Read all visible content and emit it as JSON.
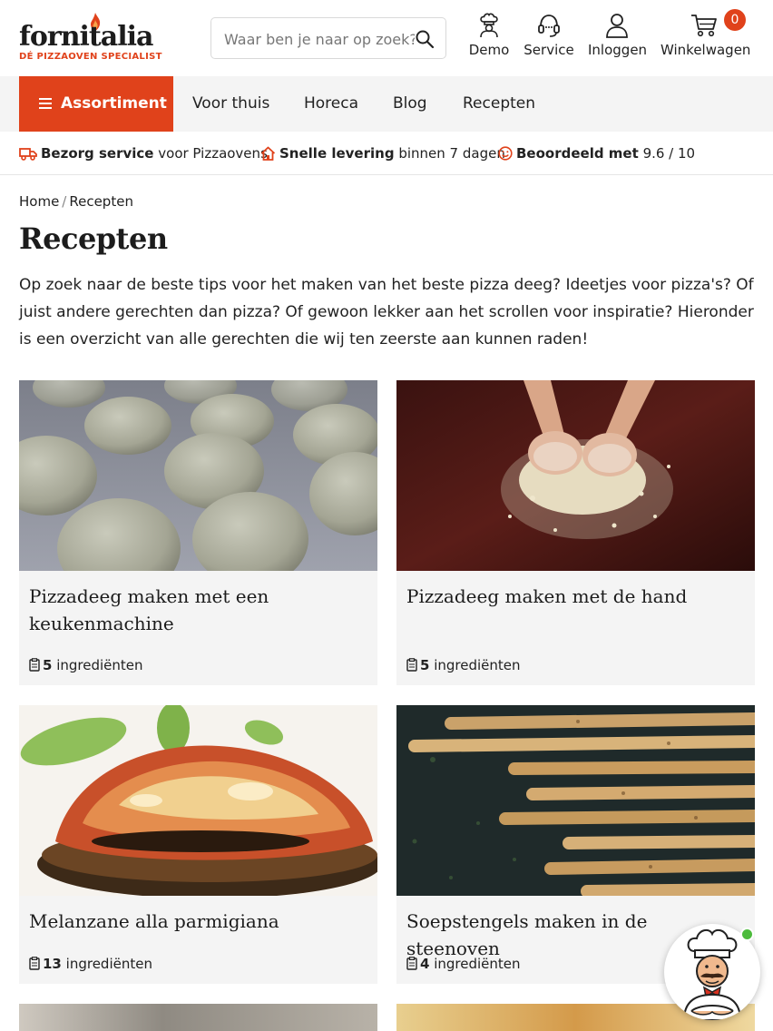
{
  "brand": {
    "name": "fornitalia",
    "tagline": "DÉ PIZZAOVEN SPECIALIST",
    "accent": "#e0421b"
  },
  "search": {
    "placeholder": "Waar ben je naar op zoek?",
    "icon": "search-icon"
  },
  "header_actions": {
    "demo": {
      "label": "Demo",
      "icon": "chef-icon"
    },
    "service": {
      "label": "Service",
      "icon": "headset-icon"
    },
    "login": {
      "label": "Inloggen",
      "icon": "user-icon"
    },
    "cart": {
      "label": "Winkelwagen",
      "icon": "cart-icon",
      "count": "0"
    }
  },
  "nav": {
    "assortment": "Assortiment",
    "items": [
      "Voor thuis",
      "Horeca",
      "Blog",
      "Recepten"
    ]
  },
  "usps": [
    {
      "icon": "truck-icon",
      "bold": "Bezorg service",
      "text": "voor Pizzaovens"
    },
    {
      "icon": "home-icon",
      "bold": "Snelle levering",
      "text": "binnen 7 dagen"
    },
    {
      "icon": "smiley-icon",
      "bold": "Beoordeeld met",
      "text": "9.6 / 10"
    }
  ],
  "breadcrumb": {
    "home": "Home",
    "separator": "/",
    "current": "Recepten"
  },
  "page": {
    "title": "Recepten",
    "intro": "Op zoek naar de beste tips voor het maken van het beste pizza deeg? Ideetjes voor pizza's? Of juist andere gerechten dan pizza? Of gewoon lekker aan het scrollen voor inspiratie? Hieronder is een overzicht van alle gerechten die wij ten zeerste aan kunnen raden!"
  },
  "recipes": [
    {
      "title": "Pizzadeeg maken met een keukenmachine",
      "count": "5",
      "unit": "ingrediënten",
      "image": "dough-balls-photo"
    },
    {
      "title": "Pizzadeeg maken met de hand",
      "count": "5",
      "unit": "ingrediënten",
      "image": "kneading-dough-photo"
    },
    {
      "title": "Melanzane alla parmigiana",
      "count": "13",
      "unit": "ingrediënten",
      "image": "melanzane-photo"
    },
    {
      "title": "Soepstengels maken in de steenoven",
      "count": "4",
      "unit": "ingrediënten",
      "image": "breadsticks-photo"
    }
  ],
  "chat": {
    "icon": "chef-mascot-icon",
    "status_color": "#4cbb3c"
  }
}
